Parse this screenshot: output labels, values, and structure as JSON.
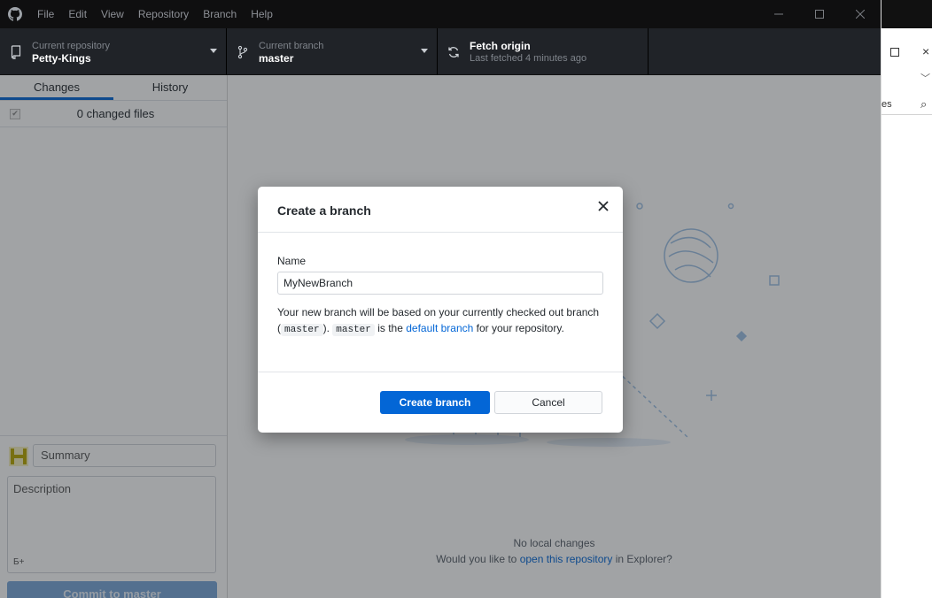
{
  "menubar": {
    "items": [
      "File",
      "Edit",
      "View",
      "Repository",
      "Branch",
      "Help"
    ]
  },
  "toolbar": {
    "repo": {
      "label": "Current repository",
      "value": "Petty-Kings"
    },
    "branch": {
      "label": "Current branch",
      "value": "master"
    },
    "fetch": {
      "label": "Fetch origin",
      "sub": "Last fetched 4 minutes ago"
    }
  },
  "sidebar": {
    "tabs": [
      "Changes",
      "History"
    ],
    "changed_files": "0 changed files",
    "summary_placeholder": "Summary",
    "description_placeholder": "Description",
    "coauthor_icon": "Б+",
    "commit_button": "Commit to master"
  },
  "main": {
    "no_changes": "No local changes",
    "explorer_prefix": "Would you like to ",
    "explorer_link": "open this repository",
    "explorer_suffix": " in Explorer?"
  },
  "dialog": {
    "title": "Create a branch",
    "name_label": "Name",
    "name_value": "MyNewBranch",
    "help_1": "Your new branch will be based on your currently checked out branch (",
    "help_code1": "master",
    "help_2": "). ",
    "help_code2": "master",
    "help_3": " is the ",
    "help_link": "default branch",
    "help_4": " for your repository.",
    "create_button": "Create branch",
    "cancel_button": "Cancel"
  },
  "background_window": {
    "fragment": "es"
  },
  "colors": {
    "accent": "#0366d6",
    "toolbar_bg": "#202328",
    "menubar_bg": "#0f0f10"
  }
}
